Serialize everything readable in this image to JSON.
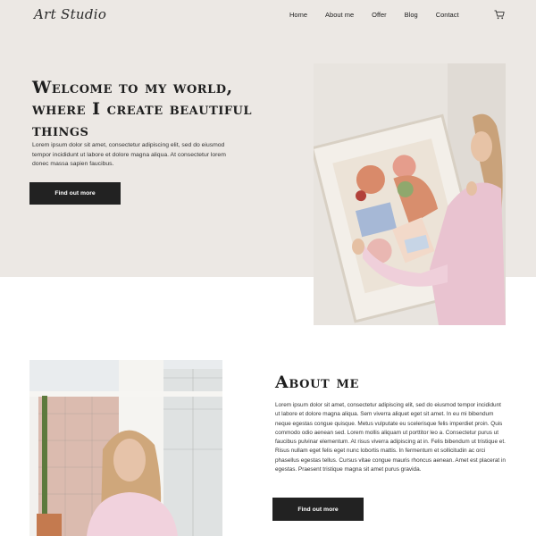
{
  "header": {
    "logo": "Art Studio",
    "nav": [
      "Home",
      "About me",
      "Offer",
      "Blog",
      "Contact"
    ],
    "cart_icon": "shopping-cart-icon"
  },
  "hero": {
    "title": "Welcome to my world, where I create beautiful things",
    "text": "Lorem ipsum dolor sit amet, consectetur adipiscing elit, sed do eiusmod tempor incididunt ut labore et dolore magna aliqua. At consectetur lorem donec massa sapien faucibus.",
    "button": "Find out more",
    "background_color": "#ece8e4"
  },
  "about": {
    "title": "About me",
    "text": "Lorem ipsum dolor sit amet, consectetur adipiscing elit, sed do eiusmod tempor incididunt ut labore et dolore magna aliqua. Sem viverra aliquet eget sit amet. In eu mi bibendum neque egestas congue quisque. Metus vulputate eu scelerisque felis imperdiet proin. Quis commodo odio aenean sed. Lorem mollis aliquam ut porttitor leo a. Consectetur purus ut faucibus pulvinar elementum. At risus viverra adipiscing at in. Felis bibendum ut tristique et. Risus nullam eget felis eget nunc lobortis mattis. In fermentum et sollicitudin ac orci phasellus egestas tellus. Cursus vitae congue mauris rhoncus aenean. Amet est placerat in egestas. Praesent tristique magna sit amet purus gravida.",
    "button": "Find out more"
  }
}
